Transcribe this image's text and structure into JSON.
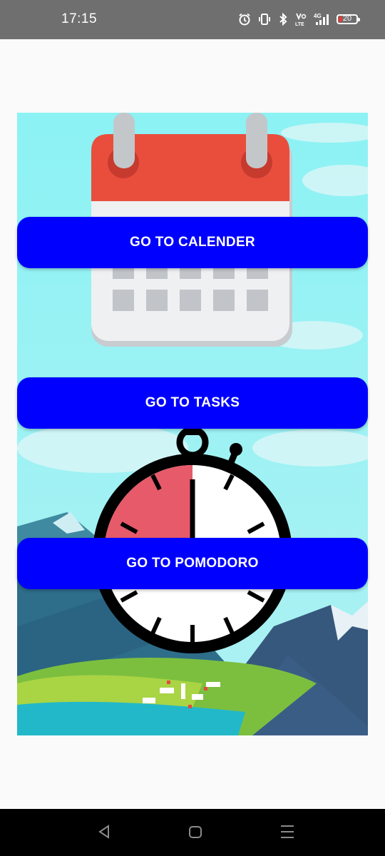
{
  "status_bar": {
    "time": "17:15",
    "icons": [
      "alarm-icon",
      "vibrate-icon",
      "bluetooth-icon",
      "volte-icon",
      "signal-4g-icon",
      "battery-icon"
    ],
    "volte_label": "Vo LTE",
    "network_label": "4G",
    "battery_level": "20",
    "battery_fraction": 0.2,
    "battery_color": "#e53935"
  },
  "background": {
    "illustration": "calendar-stopwatch-mountain-illustration",
    "sky_color": "#8df0f3"
  },
  "buttons": {
    "calendar_label": "GO TO CALENDER",
    "tasks_label": "GO TO TASKS",
    "pomodoro_label": "GO TO POMODORO",
    "color": "#0000ff"
  },
  "nav_bar": {
    "items": [
      "back-icon",
      "home-icon",
      "recents-icon"
    ]
  }
}
